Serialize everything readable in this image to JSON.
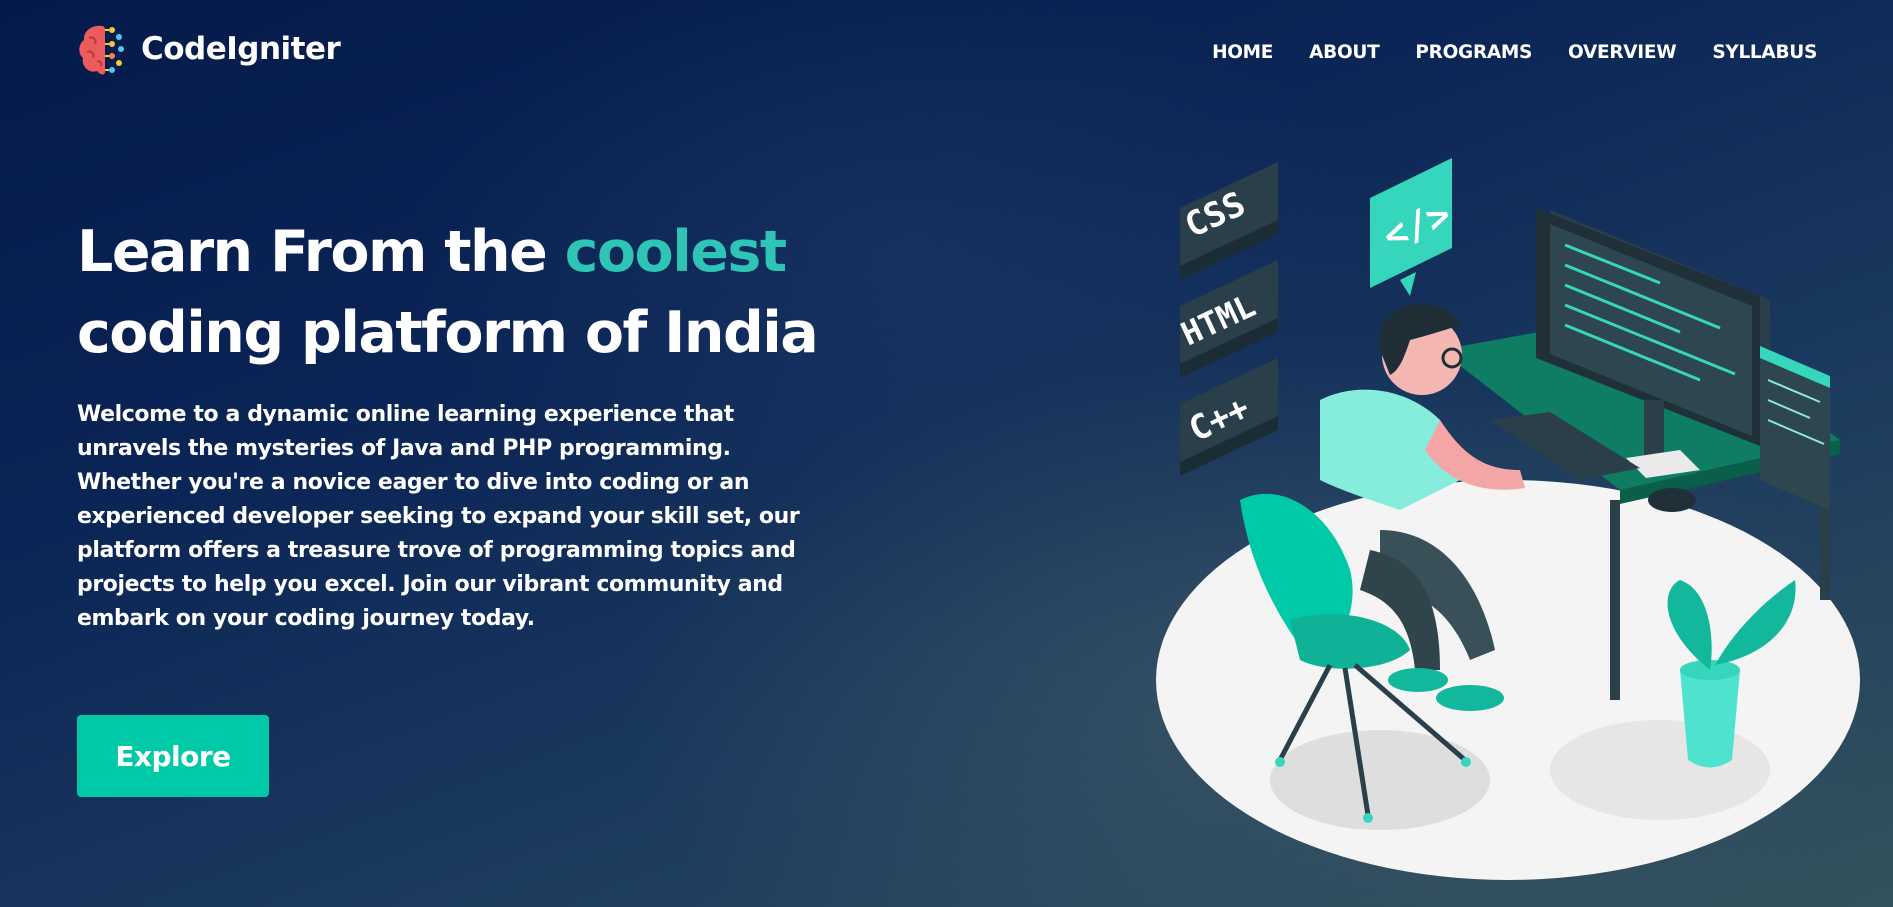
{
  "brand": {
    "name": "CodeIgniter",
    "logo_icon": "brain-icon"
  },
  "nav": {
    "items": [
      "HOME",
      "ABOUT",
      "PROGRAMS",
      "OVERVIEW",
      "SYLLABUS"
    ]
  },
  "hero": {
    "title_part1": "Learn From the ",
    "title_accent": "coolest",
    "title_line2": "coding platform of India",
    "description": "Welcome to a dynamic online learning experience that unravels the mysteries of Java and PHP programming. Whether you're a novice eager to dive into coding or an experienced developer seeking to expand your skill set, our platform offers a treasure trove of programming topics and projects to help you excel. Join our vibrant community and embark on your coding journey today.",
    "cta_label": "Explore"
  },
  "illustration": {
    "tags": [
      "CSS",
      "HTML",
      "C++"
    ],
    "bubble_text": "</>"
  },
  "colors": {
    "accent": "#2ec4b6",
    "button": "#00c9a7",
    "bg_top": "#041a4a"
  }
}
